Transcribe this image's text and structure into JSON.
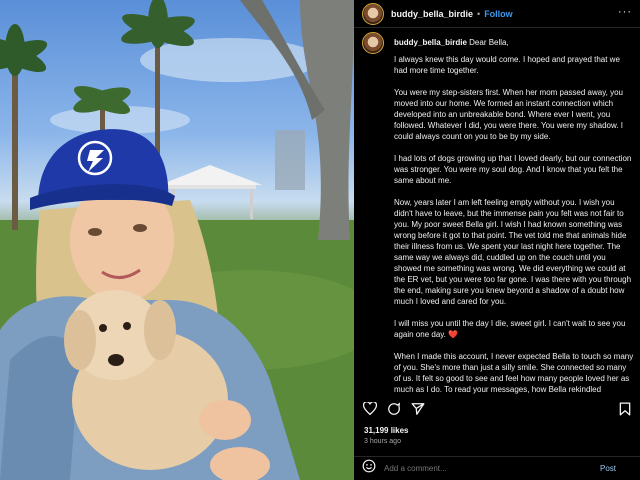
{
  "post": {
    "username": "buddy_bella_birdie",
    "separator": "•",
    "follow_label": "Follow",
    "more_label": "···",
    "caption_username": "buddy_bella_birdie",
    "caption_first": "Dear Bella,",
    "paragraphs": [
      "I always knew this day would come. I hoped and prayed that we had more time together.",
      "You were my step-sisters first. When her mom passed away, you moved into our home. We formed an instant connection which developed into an unbreakable bond. Where ever I went, you followed. Whatever I did, you were there. You were my shadow. I could always count on you to be by my side.",
      "I had lots of dogs growing up that I loved dearly, but our connection was stronger. You were my soul dog. And I know that you felt the same about me.",
      "Now, years later I am left feeling empty without you. I wish you didn't have to leave, but the immense pain you felt was not fair to you. My poor sweet Bella girl. I wish I had known something was wrong before it got to that point. The vet told me that animals hide their illness from us. We spent your last night here together. The same way we always did, cuddled up on the couch until you showed me something was wrong. We did everything we could at the ER vet, but you were too far gone. I was there with you through the end, making sure you knew beyond a shadow of a doubt how much I loved and cared for you.",
      "I will miss you until the day I die, sweet girl. I can't wait to see you again one day.",
      "When I made this account, I never expected Bella to touch so many of you. She's more than just a silly smile. She connected so many of us. It felt so good to see and feel how many people loved her as much as I do. To read your messages, how Bella rekindled relationships, how she brought you back from dark places, how she inspired you to get a dog, or how she made you"
    ],
    "heart_emoji": "❤️",
    "likes": "31,199 likes",
    "time": "3 hours ago",
    "comment_placeholder": "Add a comment...",
    "post_label": "Post"
  },
  "icons": {
    "like": "heart-icon",
    "comment": "comment-icon",
    "share": "share-icon",
    "save": "bookmark-icon",
    "emoji": "emoji-icon",
    "more": "more-icon"
  },
  "colors": {
    "follow": "#3d9af0",
    "avatar_ring": "#d4a73b",
    "cap_blue": "#1f3aa8",
    "heart": "#ed4956"
  }
}
